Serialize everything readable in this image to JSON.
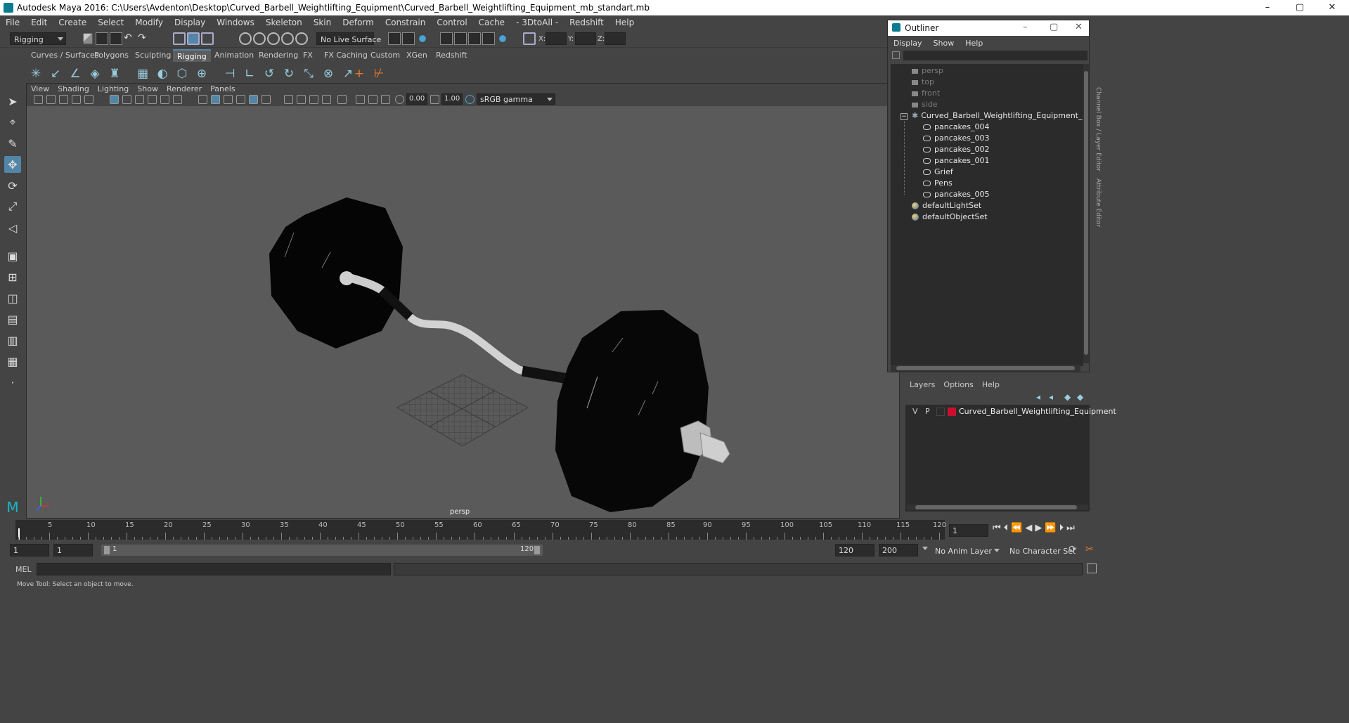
{
  "window": {
    "title": "Autodesk Maya 2016: C:\\Users\\Avdenton\\Desktop\\Curved_Barbell_Weightlifting_Equipment\\Curved_Barbell_Weightlifting_Equipment_mb_standart.mb"
  },
  "menubar": [
    "File",
    "Edit",
    "Create",
    "Select",
    "Modify",
    "Display",
    "Windows",
    "Skeleton",
    "Skin",
    "Deform",
    "Constrain",
    "Control",
    "Cache",
    "- 3DtoAll -",
    "Redshift",
    "Help"
  ],
  "statusline": {
    "mode": "Rigging",
    "live_surface": "No Live Surface",
    "x_label": "X:",
    "y_label": "Y:",
    "z_label": "Z:"
  },
  "shelf_tabs": [
    "Curves / Surfaces",
    "Polygons",
    "Sculpting",
    "Rigging",
    "Animation",
    "Rendering",
    "FX",
    "FX Caching",
    "Custom",
    "XGen",
    "Redshift"
  ],
  "active_shelf": "Rigging",
  "viewport": {
    "menu": [
      "View",
      "Shading",
      "Lighting",
      "Show",
      "Renderer",
      "Panels"
    ],
    "exposure": "0.00",
    "gamma": "1.00",
    "color_space": "sRGB gamma",
    "camera_label": "persp"
  },
  "outliner": {
    "title": "Outliner",
    "menu": [
      "Display",
      "Show",
      "Help"
    ],
    "cameras": [
      "persp",
      "top",
      "front",
      "side"
    ],
    "root": "Curved_Barbell_Weightlifting_Equipment_",
    "children": [
      "pancakes_004",
      "pancakes_003",
      "pancakes_002",
      "pancakes_001",
      "Grief",
      "Pens",
      "pancakes_005"
    ],
    "sets": [
      "defaultLightSet",
      "defaultObjectSet"
    ]
  },
  "side_tabs": [
    "Channel Box / Layer Editor",
    "Attribute Editor"
  ],
  "layers": {
    "menu": [
      "Layers",
      "Options",
      "Help"
    ],
    "v": "V",
    "p": "P",
    "layer_name": "Curved_Barbell_Weightlifting_Equipment",
    "layer_color": "#c8102e"
  },
  "timeline": {
    "ticks": [
      "5",
      "10",
      "15",
      "20",
      "25",
      "30",
      "35",
      "40",
      "45",
      "50",
      "55",
      "60",
      "65",
      "70",
      "75",
      "80",
      "85",
      "90",
      "95",
      "100",
      "105",
      "110",
      "115",
      "120"
    ],
    "start_frame": "1",
    "current_frame": "1"
  },
  "range": {
    "start": "1",
    "inner_start": "1",
    "slider_start": "1",
    "slider_end": "120",
    "end": "120",
    "max_end": "200",
    "anim_layer": "No Anim Layer",
    "character_set": "No Character Set"
  },
  "cmdline": {
    "label": "MEL"
  },
  "helpline": "Move Tool: Select an object to move."
}
